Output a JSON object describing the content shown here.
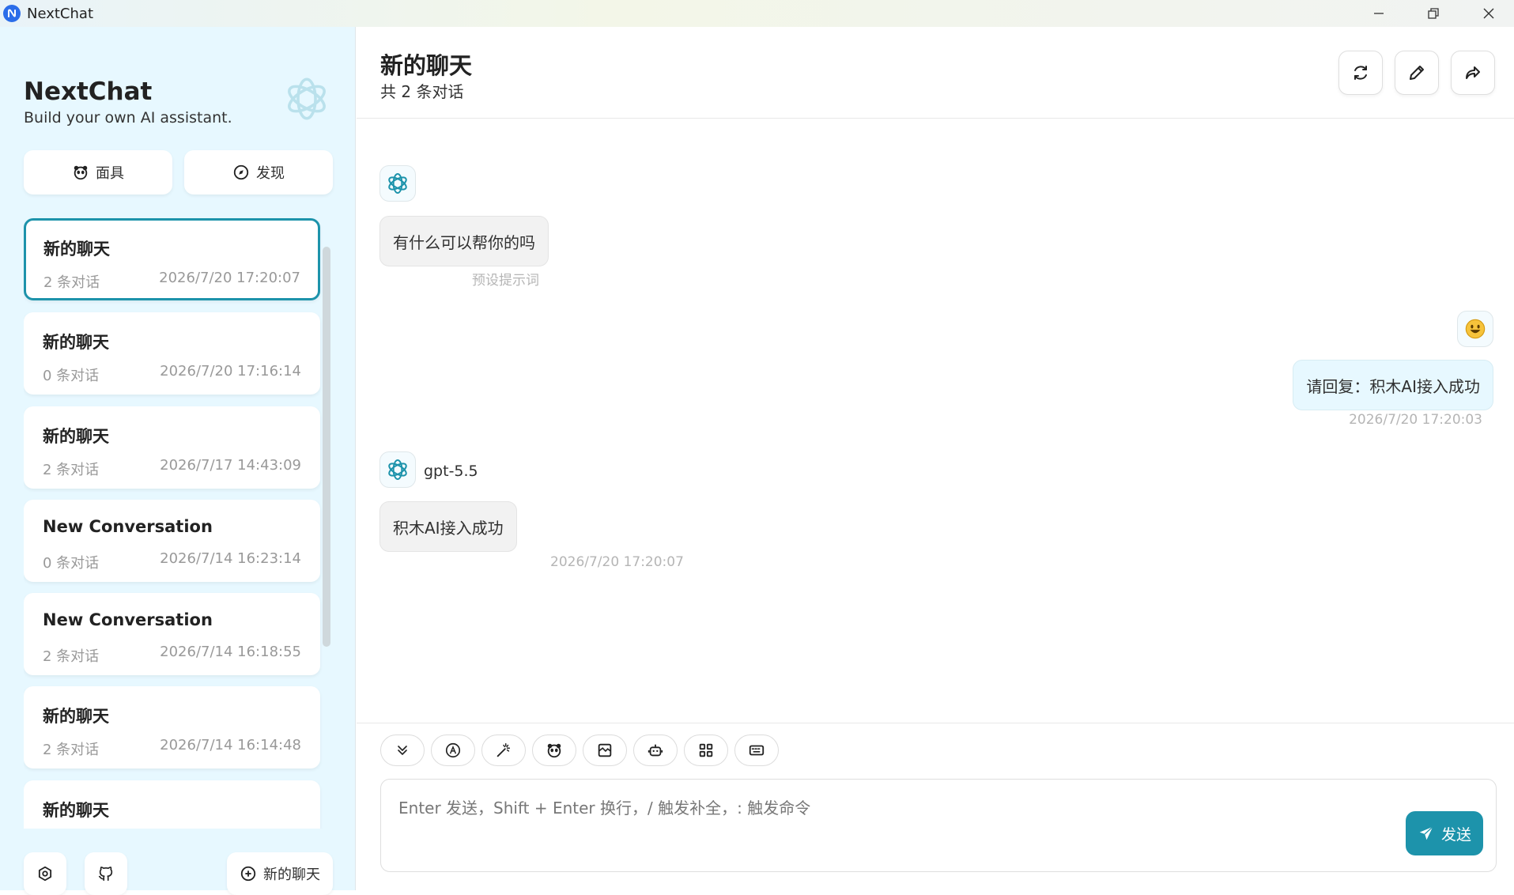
{
  "window": {
    "title": "NextChat"
  },
  "sidebar": {
    "brand_title": "NextChat",
    "brand_subtitle": "Build your own AI assistant.",
    "mask_label": "面具",
    "discover_label": "发现",
    "chats": [
      {
        "title": "新的聊天",
        "count": "2 条对话",
        "date": "2026/7/20 17:20:07",
        "selected": true
      },
      {
        "title": "新的聊天",
        "count": "0 条对话",
        "date": "2026/7/20 17:16:14"
      },
      {
        "title": "新的聊天",
        "count": "2 条对话",
        "date": "2026/7/17 14:43:09"
      },
      {
        "title": "New Conversation",
        "count": "0 条对话",
        "date": "2026/7/14 16:23:14"
      },
      {
        "title": "New Conversation",
        "count": "2 条对话",
        "date": "2026/7/14 16:18:55"
      },
      {
        "title": "新的聊天",
        "count": "2 条对话",
        "date": "2026/7/14 16:14:48"
      },
      {
        "title": "新的聊天",
        "count": "",
        "date": ""
      }
    ],
    "new_chat_label": "新的聊天"
  },
  "header": {
    "title": "新的聊天",
    "subtitle": "共 2 条对话"
  },
  "messages": [
    {
      "role": "assistant",
      "text": "有什么可以帮你的吗",
      "meta": "预设提示词"
    },
    {
      "role": "user",
      "text": "请回复：积木AI接入成功",
      "meta": "2026/7/20 17:20:03"
    },
    {
      "role": "assistant",
      "model": "gpt-5.5",
      "text": "积木AI接入成功",
      "meta": "2026/7/20 17:20:07"
    }
  ],
  "input": {
    "placeholder": "Enter 发送，Shift + Enter 换行，/ 触发补全，: 触发命令",
    "send_label": "发送"
  },
  "colors": {
    "accent": "#1d93ab",
    "sidebar_bg": "#e7f8ff"
  }
}
